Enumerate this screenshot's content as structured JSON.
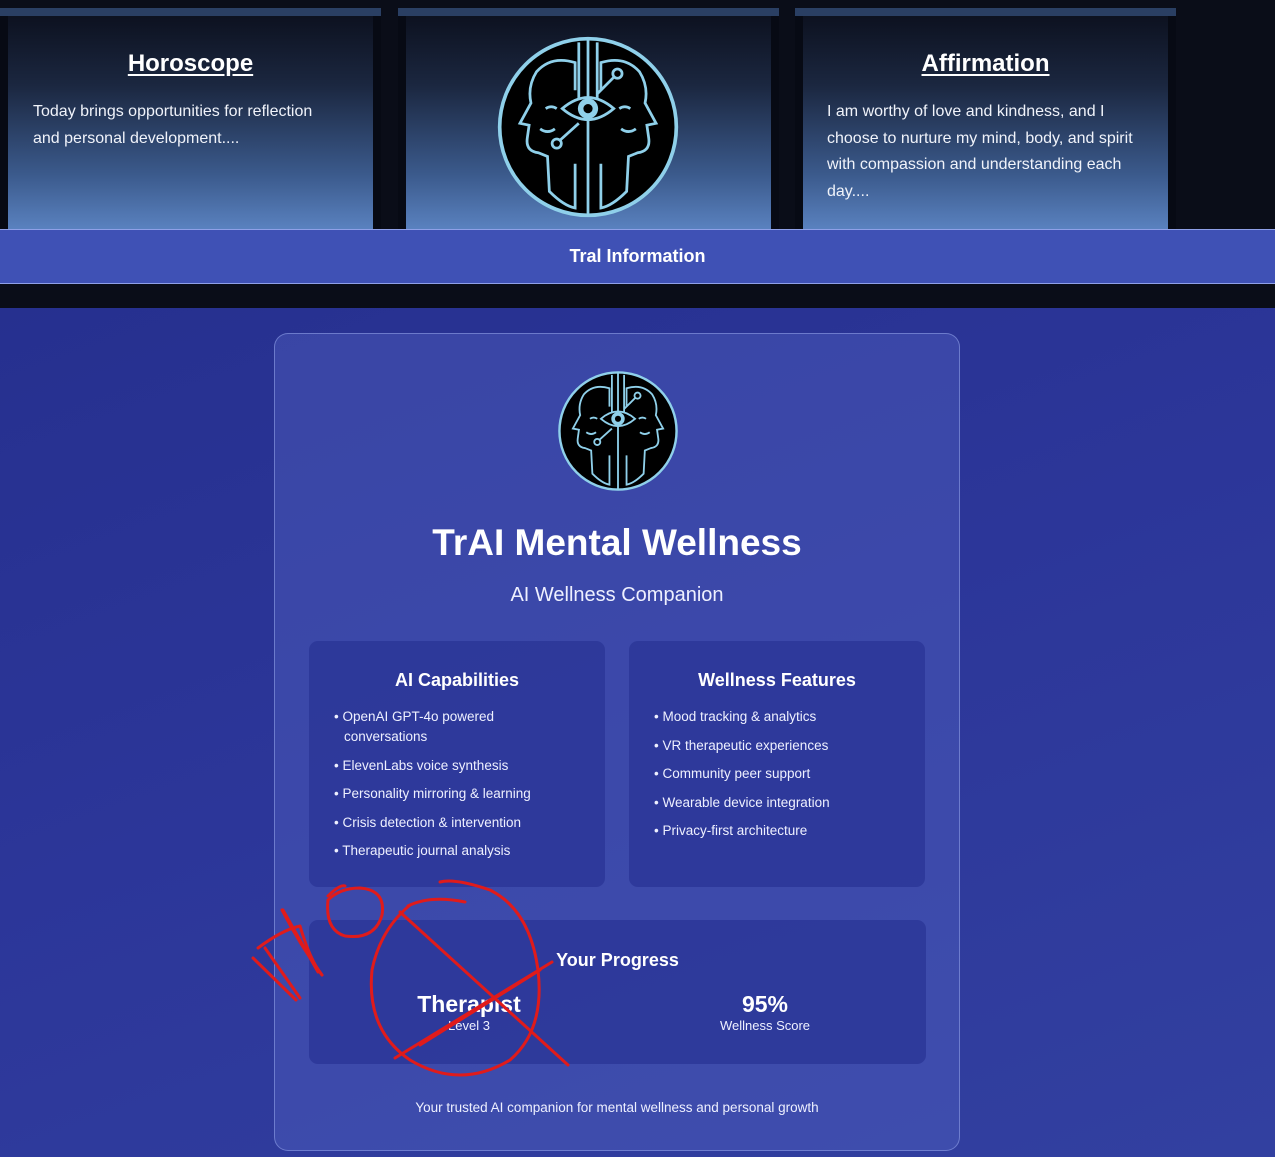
{
  "top_cards": {
    "horoscope": {
      "title": "Horoscope",
      "text": "Today brings opportunities for reflection and personal development...."
    },
    "affirmation": {
      "title": "Affirmation",
      "text": "I am worthy of love and kindness, and I choose to nurture my mind, body, and spirit with compassion and understanding each day...."
    },
    "center_logo_icon": "twin-faces-eye-icon"
  },
  "info_bar": {
    "label": "Tral Information"
  },
  "panel": {
    "logo_icon": "twin-faces-eye-icon",
    "title": "TrAI Mental Wellness",
    "subtitle": "AI Wellness Companion",
    "capabilities": {
      "title": "AI Capabilities",
      "items": [
        "OpenAI GPT-4o powered conversations",
        "ElevenLabs voice synthesis",
        "Personality mirroring & learning",
        "Crisis detection & intervention",
        "Therapeutic journal analysis"
      ]
    },
    "wellness": {
      "title": "Wellness Features",
      "items": [
        "Mood tracking & analytics",
        "VR therapeutic experiences",
        "Community peer support",
        "Wearable device integration",
        "Privacy-first architecture"
      ]
    },
    "progress": {
      "title": "Your Progress",
      "stats": [
        {
          "value": "Therapist",
          "label": "Level 3"
        },
        {
          "value": "95%",
          "label": "Wellness Score"
        }
      ]
    },
    "footer": "Your trusted AI companion for mental wellness and personal growth"
  },
  "annotation": {
    "handwritten_text": "NO",
    "color": "#e01b1b"
  },
  "colors": {
    "info_bar": "#3f51b5",
    "panel_bg": "#2c3699",
    "logo_line": "#8fd0ea"
  }
}
